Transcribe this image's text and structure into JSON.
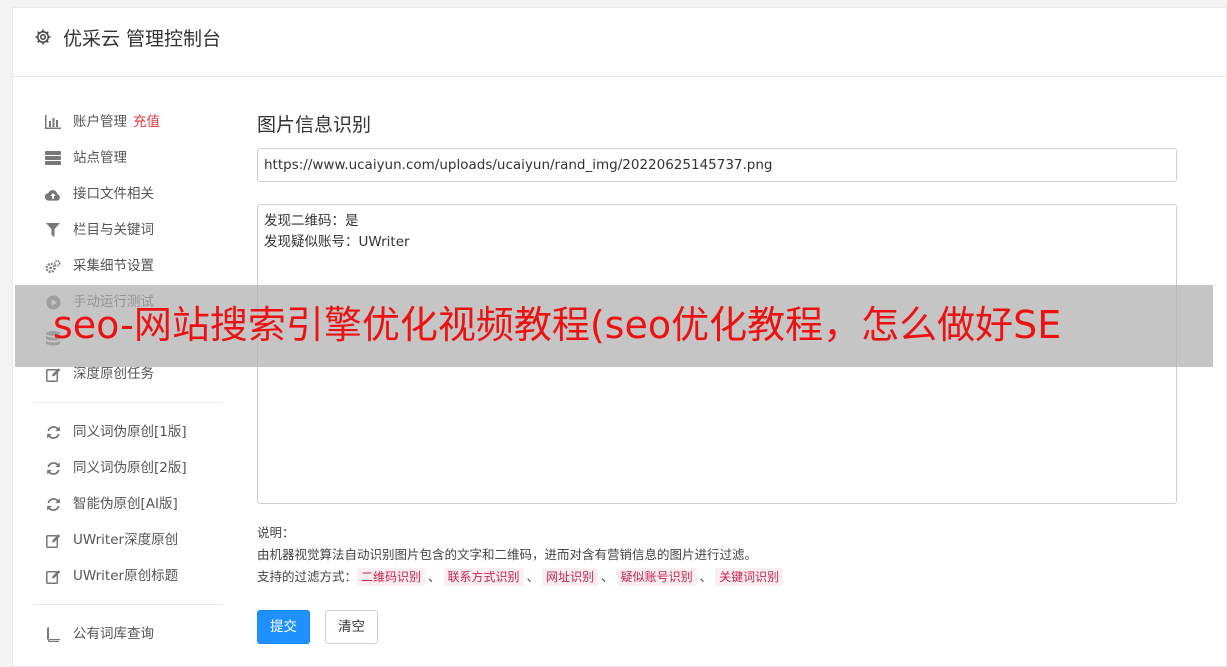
{
  "header": {
    "title": "优采云 管理控制台",
    "icon": "gear-icon"
  },
  "sidebar": {
    "groups": [
      [
        {
          "label": "账户管理",
          "badge": "充值",
          "icon": "bar-chart-icon"
        },
        {
          "label": "站点管理",
          "icon": "server-icon"
        },
        {
          "label": "接口文件相关",
          "icon": "cloud-upload-icon"
        },
        {
          "label": "栏目与关键词",
          "icon": "filter-icon"
        },
        {
          "label": "采集细节设置",
          "icon": "cogs-icon"
        },
        {
          "label": "手动运行测试",
          "icon": "play-circle-icon"
        },
        {
          "label": "",
          "icon": "database-icon"
        },
        {
          "label": "深度原创任务",
          "icon": "edit-icon"
        }
      ],
      [
        {
          "label": "同义词伪原创[1版]",
          "icon": "refresh-icon"
        },
        {
          "label": "同义词伪原创[2版]",
          "icon": "refresh-icon"
        },
        {
          "label": "智能伪原创[AI版]",
          "icon": "refresh-icon"
        },
        {
          "label": "UWriter深度原创",
          "icon": "edit-icon"
        },
        {
          "label": "UWriter原创标题",
          "icon": "edit-icon"
        }
      ],
      [
        {
          "label": "公有词库查询",
          "icon": "book-icon"
        }
      ]
    ]
  },
  "main": {
    "title": "图片信息识别",
    "url_value": "https://www.ucaiyun.com/uploads/ucaiyun/rand_img/20220625145737.png",
    "result_lines": [
      "发现二维码：是",
      "发现疑似账号：UWriter"
    ],
    "notes": {
      "heading": "说明：",
      "description": "由机器视觉算法自动识别图片包含的文字和二维码，进而对含有营销信息的图片进行过滤。",
      "filter_prefix": "支持的过滤方式：",
      "filters": [
        "二维码识别",
        "联系方式识别",
        "网址识别",
        "疑似账号识别",
        "关键词识别"
      ],
      "separator": "、"
    },
    "submit_label": "提交",
    "clear_label": "清空"
  },
  "overlay": {
    "text": "seo-网站搜索引擎优化视频教程(seo优化教程，怎么做好SE"
  },
  "colors": {
    "accent": "#1e90ff",
    "badge": "#e4393c",
    "chip_text": "#c7254e",
    "overlay_text": "#ee1111"
  }
}
